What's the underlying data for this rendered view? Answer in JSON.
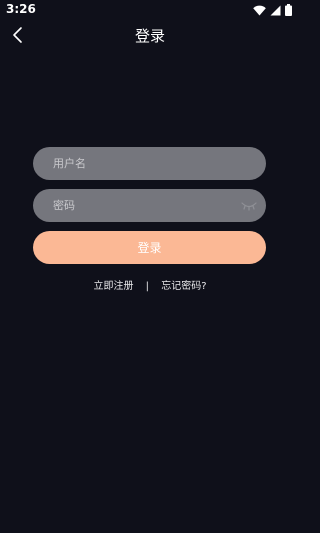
{
  "status_bar": {
    "time": "3:26",
    "icons": [
      "wifi-icon",
      "cellular-signal-icon",
      "battery-icon"
    ]
  },
  "header": {
    "back_icon": "chevron-left-icon",
    "title": "登录"
  },
  "form": {
    "username_placeholder": "用户名",
    "username_value": "",
    "password_placeholder": "密码",
    "password_value": "",
    "password_toggle_icon": "eye-closed-icon"
  },
  "login_button": {
    "label": "登录"
  },
  "links": {
    "register": "立即注册",
    "separator": "|",
    "forgot_password": "忘记密码?"
  },
  "colors": {
    "background": "#0f101a",
    "field": "#75767d",
    "accent": "#fbb895"
  }
}
